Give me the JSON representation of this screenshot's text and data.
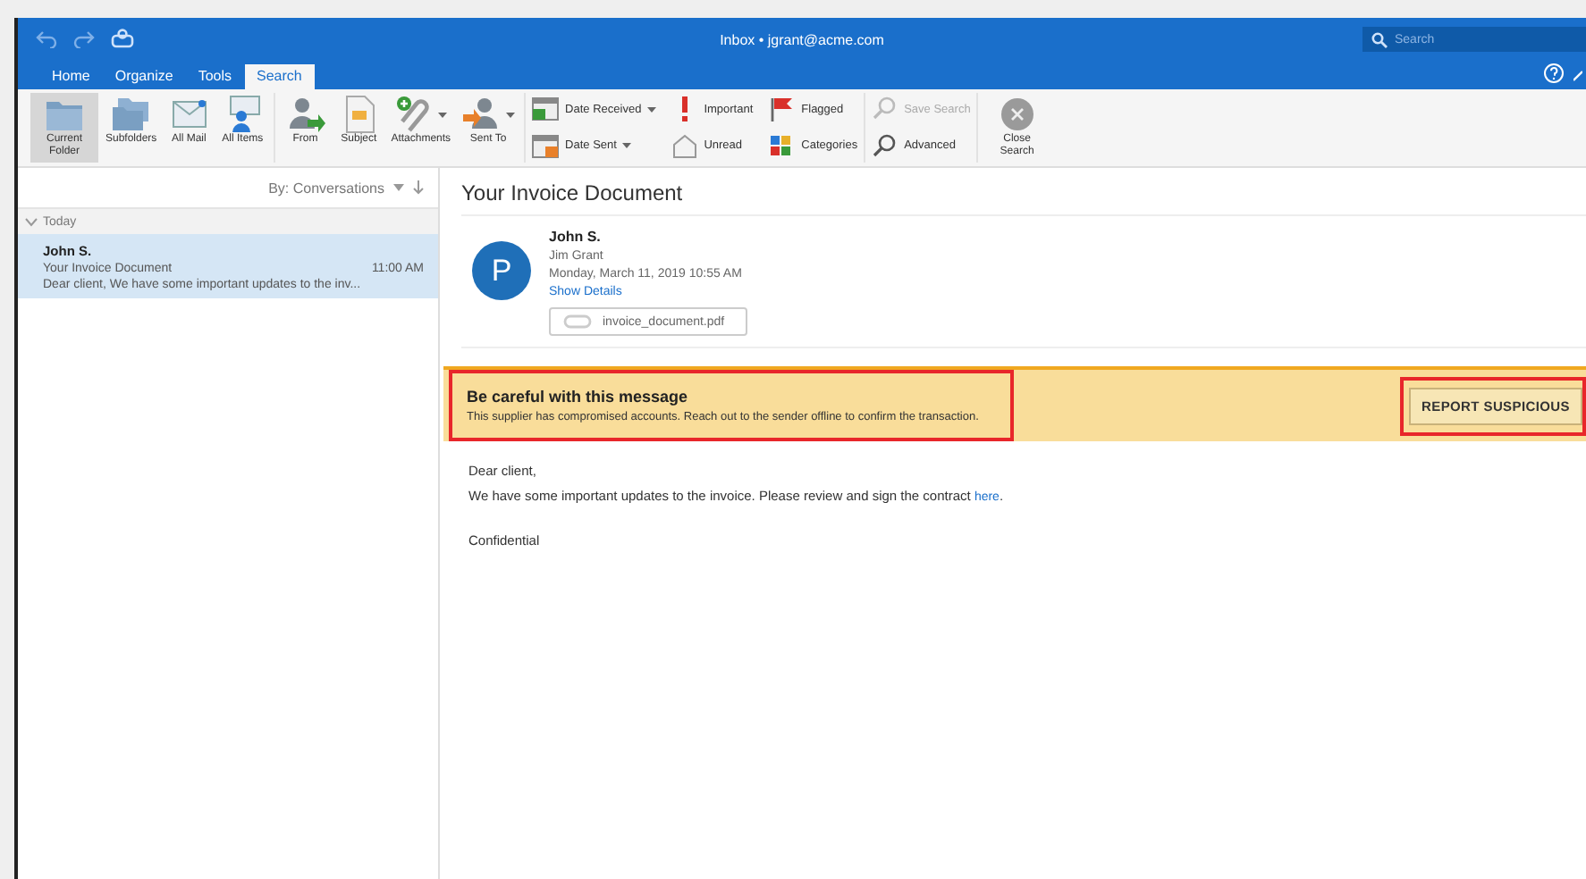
{
  "window": {
    "title": "Inbox • jgrant@acme.com",
    "search": {
      "placeholder": "Search"
    }
  },
  "tabs": [
    {
      "label": "Home",
      "selected": false
    },
    {
      "label": "Organize",
      "selected": false
    },
    {
      "label": "Tools",
      "selected": false
    },
    {
      "label": "Search",
      "selected": true
    }
  ],
  "ribbon": {
    "groups": [
      {
        "kind": "large",
        "items": [
          {
            "label": "Current Folder",
            "selected": true,
            "dropdown": false,
            "disabled": false
          },
          {
            "label": "Subfolders",
            "selected": false,
            "dropdown": false,
            "disabled": false
          },
          {
            "label": "All Mail",
            "selected": false,
            "dropdown": false,
            "disabled": false
          },
          {
            "label": "All Items",
            "selected": false,
            "dropdown": false,
            "disabled": false
          }
        ]
      },
      {
        "kind": "large",
        "items": [
          {
            "label": "From",
            "selected": false,
            "dropdown": false,
            "disabled": false
          },
          {
            "label": "Subject",
            "selected": false,
            "dropdown": false,
            "disabled": false
          },
          {
            "label": "Attachments",
            "selected": false,
            "dropdown": true,
            "disabled": false
          },
          {
            "label": "Sent To",
            "selected": false,
            "dropdown": true,
            "disabled": false
          }
        ]
      },
      {
        "kind": "small",
        "items": [
          {
            "label": "Date Received",
            "selected": false,
            "dropdown": true,
            "disabled": false
          },
          {
            "label": "Date Sent",
            "selected": false,
            "dropdown": true,
            "disabled": false
          },
          {
            "label": "Important",
            "selected": false,
            "dropdown": false,
            "disabled": false
          },
          {
            "label": "Unread",
            "selected": false,
            "dropdown": false,
            "disabled": false
          },
          {
            "label": "Flagged",
            "selected": false,
            "dropdown": false,
            "disabled": false
          },
          {
            "label": "Categories",
            "selected": false,
            "dropdown": false,
            "disabled": false
          }
        ]
      },
      {
        "kind": "small",
        "items": [
          {
            "label": "Save Search",
            "selected": false,
            "dropdown": false,
            "disabled": true
          },
          {
            "label": "Advanced",
            "selected": false,
            "dropdown": false,
            "disabled": false
          }
        ]
      },
      {
        "kind": "large",
        "items": [
          {
            "label": "Close Search",
            "selected": false,
            "dropdown": false,
            "disabled": false
          }
        ]
      }
    ]
  },
  "message_list": {
    "sort": "By: Conversations",
    "groups": [
      {
        "label": "Today",
        "expanded": true,
        "messages": [
          {
            "sender": "John S.",
            "subject": "Your Invoice Document",
            "time": "11:00 AM",
            "preview": "Dear client, We have some important updates to the inv...",
            "selected": true
          }
        ]
      }
    ]
  },
  "reading_pane": {
    "subject": "Your Invoice Document",
    "avatar": "P",
    "sender": "John S.",
    "recipient": "Jim Grant",
    "date": "Monday, March 11, 2019 10:55 AM",
    "details_link": "Show Details",
    "attachment": "invoice_document.pdf",
    "warning": {
      "title": "Be careful with this message",
      "text": "This supplier has compromised accounts. Reach out to the sender offline to confirm the transaction.",
      "button": "REPORT SUSPICIOUS"
    },
    "body": [
      {
        "text": "Dear client,"
      },
      {
        "text": "We have some important updates to the invoice.  Please review and sign the contract ",
        "link": "here",
        "after": "."
      },
      {
        "text": "Confidential"
      }
    ]
  }
}
